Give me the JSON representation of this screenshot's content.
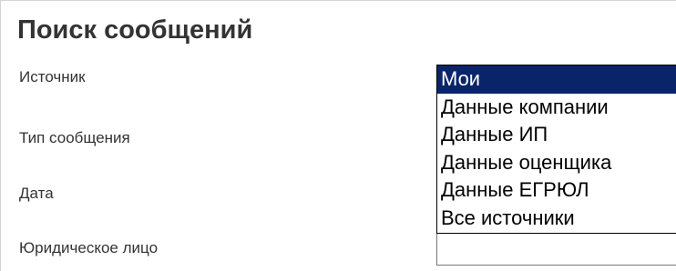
{
  "page": {
    "title": "Поиск сообщений"
  },
  "form": {
    "source_label": "Источник",
    "message_type_label": "Тип сообщения",
    "date_label": "Дата",
    "legal_entity_label": "Юридическое лицо"
  },
  "source_dropdown": {
    "selected": "Мои",
    "options": [
      "Мои",
      "Данные компании",
      "Данные ИП",
      "Данные оценщика",
      "Данные ЕГРЮЛ",
      "Все источники"
    ]
  },
  "colors": {
    "selected_bg": "#0a246a",
    "selected_text": "#ffffff",
    "label_text": "#333333"
  }
}
